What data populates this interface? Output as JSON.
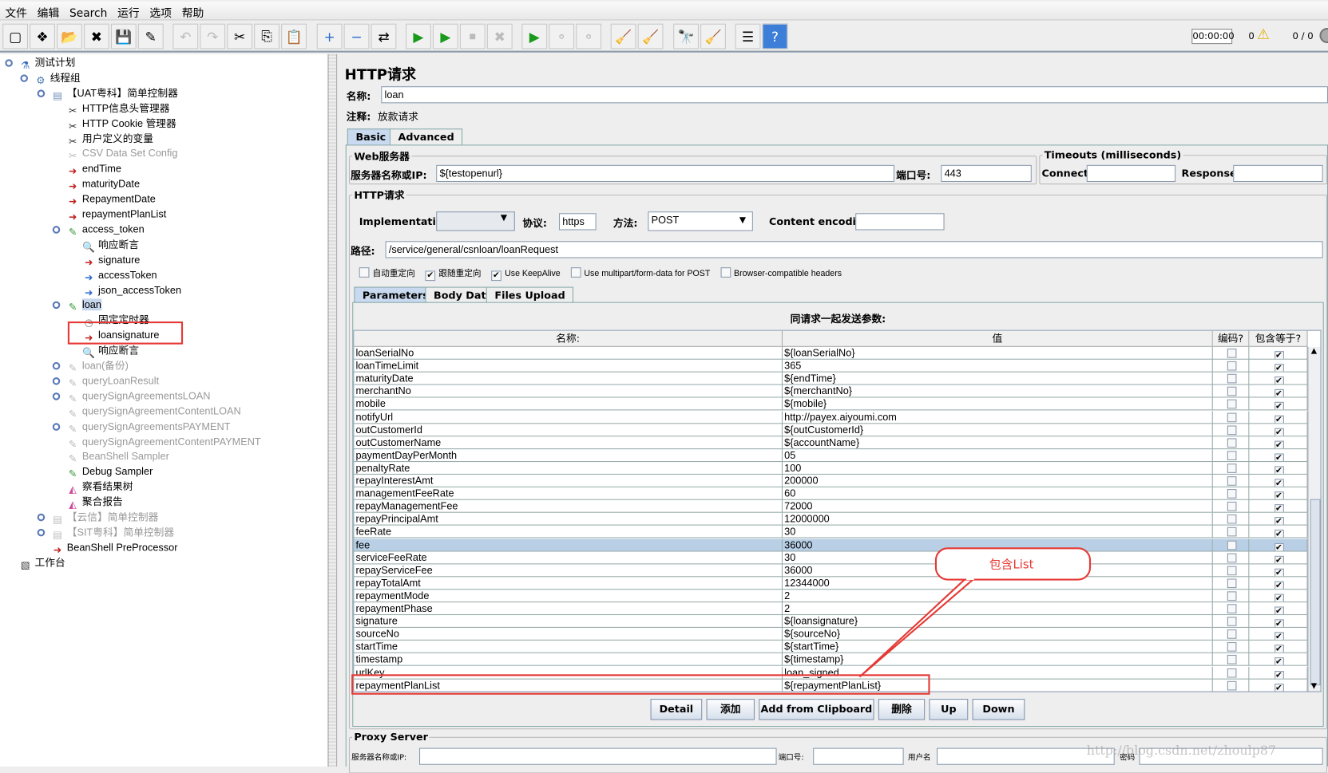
{
  "menu": [
    "文件",
    "编辑",
    "Search",
    "运行",
    "选项",
    "帮助"
  ],
  "status": {
    "timer": "00:00:00",
    "warnings": "0",
    "threads": "0 / 0"
  },
  "tree": [
    {
      "label": "测试计划",
      "level": 0,
      "icon": "flask-icon",
      "state": "normal"
    },
    {
      "label": "线程组",
      "level": 1,
      "icon": "gear-icon",
      "state": "normal"
    },
    {
      "label": "【UAT粤科】简单控制器",
      "level": 2,
      "icon": "controller-icon",
      "state": "normal"
    },
    {
      "label": "HTTP信息头管理器",
      "level": 3,
      "icon": "wrench-icon",
      "state": "normal"
    },
    {
      "label": "HTTP Cookie 管理器",
      "level": 3,
      "icon": "wrench-icon",
      "state": "normal"
    },
    {
      "label": "用户定义的变量",
      "level": 3,
      "icon": "wrench-icon",
      "state": "normal"
    },
    {
      "label": "CSV Data Set Config",
      "level": 3,
      "icon": "wrench-icon",
      "state": "disabled"
    },
    {
      "label": "endTime",
      "level": 3,
      "icon": "preprocessor-icon",
      "state": "normal"
    },
    {
      "label": "maturityDate",
      "level": 3,
      "icon": "preprocessor-icon",
      "state": "normal"
    },
    {
      "label": "RepaymentDate",
      "level": 3,
      "icon": "preprocessor-icon",
      "state": "normal"
    },
    {
      "label": "repaymentPlanList",
      "level": 3,
      "icon": "preprocessor-icon",
      "state": "normal"
    },
    {
      "label": "access_token",
      "level": 3,
      "icon": "pipette-icon",
      "state": "normal"
    },
    {
      "label": "响应断言",
      "level": 4,
      "icon": "magnifier-icon",
      "state": "normal"
    },
    {
      "label": "signature",
      "level": 4,
      "icon": "preprocessor-icon",
      "state": "normal"
    },
    {
      "label": "accessToken",
      "level": 4,
      "icon": "postprocessor-icon",
      "state": "normal"
    },
    {
      "label": "json_accessToken",
      "level": 4,
      "icon": "postprocessor-icon",
      "state": "normal"
    },
    {
      "label": "loan",
      "level": 3,
      "icon": "pipette-icon",
      "state": "selected"
    },
    {
      "label": "固定定时器",
      "level": 4,
      "icon": "timer-icon",
      "state": "normal"
    },
    {
      "label": "loansignature",
      "level": 4,
      "icon": "preprocessor-icon",
      "state": "normal"
    },
    {
      "label": "响应断言",
      "level": 4,
      "icon": "magnifier-icon",
      "state": "normal"
    },
    {
      "label": "loan(备份)",
      "level": 3,
      "icon": "pipette-icon",
      "state": "disabled"
    },
    {
      "label": "queryLoanResult",
      "level": 3,
      "icon": "pipette-icon",
      "state": "disabled"
    },
    {
      "label": "querySignAgreementsLOAN",
      "level": 3,
      "icon": "pipette-icon",
      "state": "disabled"
    },
    {
      "label": "querySignAgreementContentLOAN",
      "level": 3,
      "icon": "pipette-icon",
      "state": "disabled"
    },
    {
      "label": "querySignAgreementsPAYMENT",
      "level": 3,
      "icon": "pipette-icon",
      "state": "disabled"
    },
    {
      "label": "querySignAgreementContentPAYMENT",
      "level": 3,
      "icon": "pipette-icon",
      "state": "disabled"
    },
    {
      "label": "BeanShell Sampler",
      "level": 3,
      "icon": "pipette-icon",
      "state": "disabled"
    },
    {
      "label": "Debug Sampler",
      "level": 3,
      "icon": "pipette-icon",
      "state": "normal"
    },
    {
      "label": "察看结果树",
      "level": 3,
      "icon": "graph-icon",
      "state": "normal"
    },
    {
      "label": "聚合报告",
      "level": 3,
      "icon": "graph-icon",
      "state": "normal"
    },
    {
      "label": "【云信】简单控制器",
      "level": 2,
      "icon": "controller-icon",
      "state": "disabled"
    },
    {
      "label": "【SIT粤科】简单控制器",
      "level": 2,
      "icon": "controller-icon",
      "state": "disabled"
    },
    {
      "label": "BeanShell PreProcessor",
      "level": 2,
      "icon": "preprocessor-icon",
      "state": "normal"
    },
    {
      "label": "工作台",
      "level": 0,
      "icon": "workbench-icon",
      "state": "normal"
    }
  ],
  "panel": {
    "title": "HTTP请求",
    "name_label": "名称:",
    "name_value": "loan",
    "comment_label": "注释:",
    "comment_value": "放款请求",
    "tabs": [
      "Basic",
      "Advanced"
    ],
    "web_server": {
      "legend": "Web服务器",
      "server_label": "服务器名称或IP:",
      "server_value": "${testopenurl}",
      "port_label": "端口号:",
      "port_value": "443"
    },
    "timeouts": {
      "legend": "Timeouts (milliseconds)",
      "connect_label": "Connect:",
      "connect_value": "",
      "response_label": "Response:",
      "response_value": ""
    },
    "http": {
      "legend": "HTTP请求",
      "impl_label": "Implementation:",
      "impl_value": "",
      "protocol_label": "协议:",
      "protocol_value": "https",
      "method_label": "方法:",
      "method_value": "POST",
      "encoding_label": "Content encoding:",
      "encoding_value": "",
      "path_label": "路径:",
      "path_value": "/service/general/csnloan/loanRequest"
    },
    "checkboxes": [
      {
        "label": "自动重定向",
        "checked": false
      },
      {
        "label": "跟随重定向",
        "checked": true
      },
      {
        "label": "Use KeepAlive",
        "checked": true
      },
      {
        "label": "Use multipart/form-data for POST",
        "checked": false
      },
      {
        "label": "Browser-compatible headers",
        "checked": false
      }
    ],
    "param_tabs": [
      "Parameters",
      "Body Data",
      "Files Upload"
    ],
    "params_caption": "同请求一起发送参数:",
    "columns": [
      "名称:",
      "值",
      "编码?",
      "包含等于?"
    ],
    "rows": [
      {
        "name": "loanSerialNo",
        "value": "${loanSerialNo}",
        "encode": false,
        "include_equals": true
      },
      {
        "name": "loanTimeLimit",
        "value": "365",
        "encode": false,
        "include_equals": true
      },
      {
        "name": "maturityDate",
        "value": "${endTime}",
        "encode": false,
        "include_equals": true
      },
      {
        "name": "merchantNo",
        "value": "${merchantNo}",
        "encode": false,
        "include_equals": true
      },
      {
        "name": "mobile",
        "value": "${mobile}",
        "encode": false,
        "include_equals": true
      },
      {
        "name": "notifyUrl",
        "value": "http://payex.aiyoumi.com",
        "encode": false,
        "include_equals": true
      },
      {
        "name": "outCustomerId",
        "value": "${outCustomerId}",
        "encode": false,
        "include_equals": true
      },
      {
        "name": "outCustomerName",
        "value": "${accountName}",
        "encode": false,
        "include_equals": true
      },
      {
        "name": "paymentDayPerMonth",
        "value": "05",
        "encode": false,
        "include_equals": true
      },
      {
        "name": "penaltyRate",
        "value": "100",
        "encode": false,
        "include_equals": true
      },
      {
        "name": "repayInterestAmt",
        "value": "200000",
        "encode": false,
        "include_equals": true
      },
      {
        "name": "managementFeeRate",
        "value": "60",
        "encode": false,
        "include_equals": true
      },
      {
        "name": "repayManagementFee",
        "value": "72000",
        "encode": false,
        "include_equals": true
      },
      {
        "name": "repayPrincipalAmt",
        "value": "12000000",
        "encode": false,
        "include_equals": true
      },
      {
        "name": "feeRate",
        "value": "30",
        "encode": false,
        "include_equals": true
      },
      {
        "name": "fee",
        "value": "36000",
        "encode": false,
        "include_equals": true,
        "selected": true
      },
      {
        "name": "serviceFeeRate",
        "value": "30",
        "encode": false,
        "include_equals": true
      },
      {
        "name": "repayServiceFee",
        "value": "36000",
        "encode": false,
        "include_equals": true
      },
      {
        "name": "repayTotalAmt",
        "value": "12344000",
        "encode": false,
        "include_equals": true
      },
      {
        "name": "repaymentMode",
        "value": "2",
        "encode": false,
        "include_equals": true
      },
      {
        "name": "repaymentPhase",
        "value": "2",
        "encode": false,
        "include_equals": true
      },
      {
        "name": "signature",
        "value": "${loansignature}",
        "encode": false,
        "include_equals": true
      },
      {
        "name": "sourceNo",
        "value": "${sourceNo}",
        "encode": false,
        "include_equals": true
      },
      {
        "name": "startTime",
        "value": "${startTime}",
        "encode": false,
        "include_equals": true
      },
      {
        "name": "timestamp",
        "value": "${timestamp}",
        "encode": false,
        "include_equals": true
      },
      {
        "name": "urlKey",
        "value": "loan_signed",
        "encode": false,
        "include_equals": true
      },
      {
        "name": "repaymentPlanList",
        "value": "${repaymentPlanList}",
        "encode": false,
        "include_equals": true
      }
    ],
    "buttons": [
      "Detail",
      "添加",
      "Add from Clipboard",
      "删除",
      "Up",
      "Down"
    ],
    "proxy": {
      "legend": "Proxy Server",
      "server_label": "服务器名称或IP:",
      "port_label": "端口号:",
      "user_label": "用户名",
      "password_label": "密码"
    }
  },
  "annotation": {
    "callout_text": "包含List",
    "color": "#e53935"
  },
  "watermark": "http://blog.csdn.net/zhoulp87"
}
